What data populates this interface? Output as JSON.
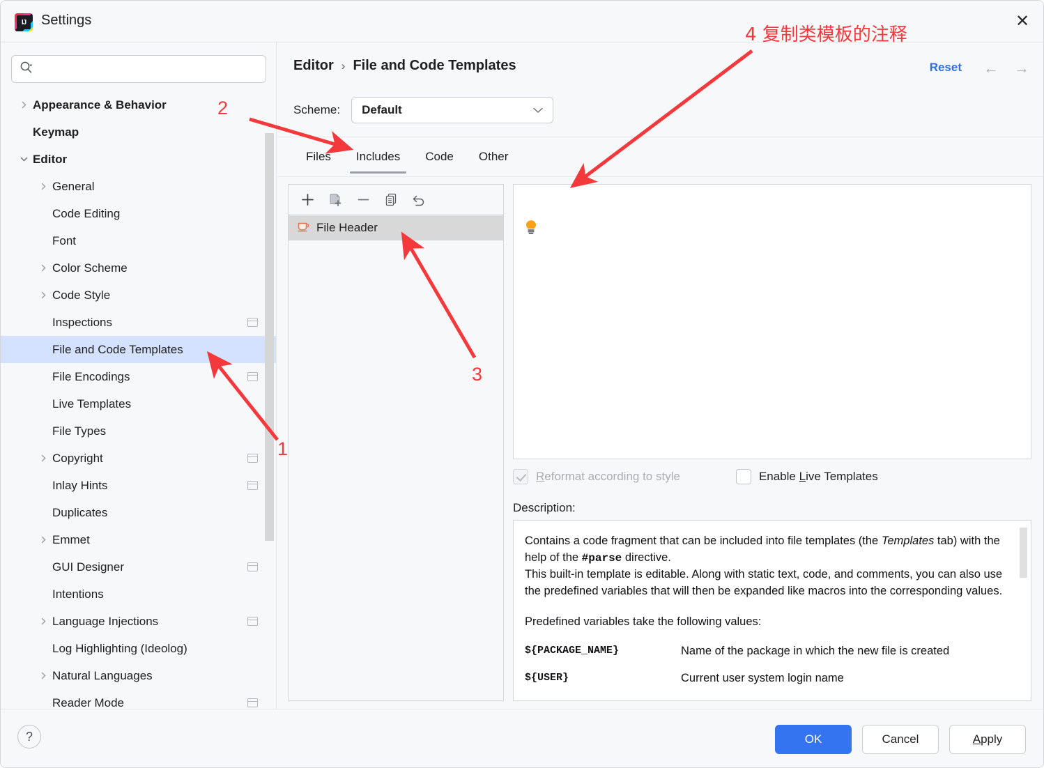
{
  "window": {
    "title": "Settings",
    "logo_text": "IJ",
    "close_icon": "✕"
  },
  "search": {
    "value": "",
    "placeholder": ""
  },
  "sidebar": {
    "items": [
      {
        "label": "Appearance & Behavior",
        "level": 0,
        "expandable": true,
        "expanded": false,
        "selected": false,
        "copyable": false
      },
      {
        "label": "Keymap",
        "level": 0,
        "expandable": false,
        "expanded": false,
        "selected": false,
        "copyable": false
      },
      {
        "label": "Editor",
        "level": 0,
        "expandable": true,
        "expanded": true,
        "selected": false,
        "copyable": false
      },
      {
        "label": "General",
        "level": 1,
        "expandable": true,
        "expanded": false,
        "selected": false,
        "copyable": false
      },
      {
        "label": "Code Editing",
        "level": 1,
        "expandable": false,
        "expanded": false,
        "selected": false,
        "copyable": false
      },
      {
        "label": "Font",
        "level": 1,
        "expandable": false,
        "expanded": false,
        "selected": false,
        "copyable": false
      },
      {
        "label": "Color Scheme",
        "level": 1,
        "expandable": true,
        "expanded": false,
        "selected": false,
        "copyable": false
      },
      {
        "label": "Code Style",
        "level": 1,
        "expandable": true,
        "expanded": false,
        "selected": false,
        "copyable": false
      },
      {
        "label": "Inspections",
        "level": 1,
        "expandable": false,
        "expanded": false,
        "selected": false,
        "copyable": true
      },
      {
        "label": "File and Code Templates",
        "level": 1,
        "expandable": false,
        "expanded": false,
        "selected": true,
        "copyable": false
      },
      {
        "label": "File Encodings",
        "level": 1,
        "expandable": false,
        "expanded": false,
        "selected": false,
        "copyable": true
      },
      {
        "label": "Live Templates",
        "level": 1,
        "expandable": false,
        "expanded": false,
        "selected": false,
        "copyable": false
      },
      {
        "label": "File Types",
        "level": 1,
        "expandable": false,
        "expanded": false,
        "selected": false,
        "copyable": false
      },
      {
        "label": "Copyright",
        "level": 1,
        "expandable": true,
        "expanded": false,
        "selected": false,
        "copyable": true
      },
      {
        "label": "Inlay Hints",
        "level": 1,
        "expandable": false,
        "expanded": false,
        "selected": false,
        "copyable": true
      },
      {
        "label": "Duplicates",
        "level": 1,
        "expandable": false,
        "expanded": false,
        "selected": false,
        "copyable": false
      },
      {
        "label": "Emmet",
        "level": 1,
        "expandable": true,
        "expanded": false,
        "selected": false,
        "copyable": false
      },
      {
        "label": "GUI Designer",
        "level": 1,
        "expandable": false,
        "expanded": false,
        "selected": false,
        "copyable": true
      },
      {
        "label": "Intentions",
        "level": 1,
        "expandable": false,
        "expanded": false,
        "selected": false,
        "copyable": false
      },
      {
        "label": "Language Injections",
        "level": 1,
        "expandable": true,
        "expanded": false,
        "selected": false,
        "copyable": true
      },
      {
        "label": "Log Highlighting (Ideolog)",
        "level": 1,
        "expandable": false,
        "expanded": false,
        "selected": false,
        "copyable": false
      },
      {
        "label": "Natural Languages",
        "level": 1,
        "expandable": true,
        "expanded": false,
        "selected": false,
        "copyable": false
      },
      {
        "label": "Reader Mode",
        "level": 1,
        "expandable": false,
        "expanded": false,
        "selected": false,
        "copyable": true
      }
    ]
  },
  "header": {
    "breadcrumb_parent": "Editor",
    "breadcrumb_separator": "›",
    "breadcrumb_current": "File and Code Templates",
    "reset_label": "Reset",
    "back_icon": "←",
    "forward_icon": "→"
  },
  "scheme": {
    "label": "Scheme:",
    "value": "Default",
    "caret": "∨"
  },
  "tabs": [
    {
      "label": "Files",
      "active": false
    },
    {
      "label": "Includes",
      "active": true
    },
    {
      "label": "Code",
      "active": false
    },
    {
      "label": "Other",
      "active": false
    }
  ],
  "list_toolbar": [
    {
      "name": "add",
      "glyph": "+"
    },
    {
      "name": "add-template-from-file",
      "glyph": ""
    },
    {
      "name": "remove",
      "glyph": "—"
    },
    {
      "name": "copy",
      "glyph": ""
    },
    {
      "name": "revert",
      "glyph": "↶"
    }
  ],
  "template_list": [
    {
      "label": "File Header",
      "selected": true,
      "icon": "java-file-icon"
    }
  ],
  "editor": {
    "content": "",
    "hint_icon": "lightbulb-icon"
  },
  "options": {
    "reformat_label_prefix": "",
    "reformat_label": "Reformat according to style",
    "reformat_checked": true,
    "reformat_disabled": true,
    "live_templates_label_before": "Enable ",
    "live_templates_mnemonic": "L",
    "live_templates_label_after": "ive Templates",
    "live_templates_checked": false
  },
  "description": {
    "label": "Description:",
    "para1_a": "Contains a code fragment that can be included into file templates (the ",
    "para1_italic": "Templates",
    "para1_b": " tab) with the help of the ",
    "para1_mono": "#parse",
    "para1_c": " directive.",
    "para2": "This built-in template is editable. Along with static text, code, and comments, you can also use the predefined variables that will then be expanded like macros into the corresponding values.",
    "para3": "Predefined variables take the following values:",
    "variables": [
      {
        "name": "${PACKAGE_NAME}",
        "desc": "Name of the package in which the new file is created"
      },
      {
        "name": "${USER}",
        "desc": "Current user system login name"
      }
    ]
  },
  "footer": {
    "help_glyph": "?",
    "ok_label": "OK",
    "cancel_label": "Cancel",
    "apply_mnemonic": "A",
    "apply_rest": "pply"
  },
  "annotations": {
    "n1": "1",
    "n2": "2",
    "n3": "3",
    "n4_text": "4 复制类模板的注释"
  },
  "colors": {
    "accent_blue": "#3574f0",
    "link_blue": "#2f6fde",
    "selection_blue": "#d4e2ff",
    "annotation_red": "#f4393c",
    "bulb_yellow": "#fca016",
    "java_icon_orange": "#e8714a"
  }
}
